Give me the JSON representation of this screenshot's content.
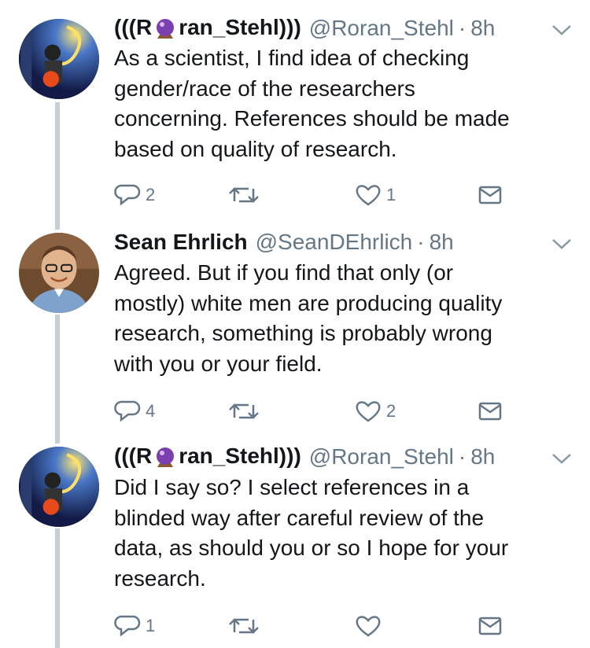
{
  "tweets": [
    {
      "name_prefix": "(((R",
      "name_suffix": "ran_Stehl)))",
      "handle": "@Roran_Stehl",
      "time": "8h",
      "lines": [
        "As a scientist, I find idea of checking",
        "gender/race of the researchers",
        "concerning. References should be made",
        "based on quality of research."
      ],
      "replies": "2",
      "retweets": "",
      "likes": "1"
    },
    {
      "name_prefix": "Sean Ehrlich",
      "name_suffix": "",
      "handle": "@SeanDEhrlich",
      "time": "8h",
      "lines": [
        "Agreed. But if you find that only (or",
        "mostly) white men are producing quality",
        "research, something is probably wrong",
        "with you or your field."
      ],
      "replies": "4",
      "retweets": "",
      "likes": "2"
    },
    {
      "name_prefix": "(((R",
      "name_suffix": "ran_Stehl)))",
      "handle": "@Roran_Stehl",
      "time": "8h",
      "lines": [
        "Did I say so? I select references in a",
        "blinded way after careful review of the",
        "data, as should you or so I hope for your",
        "research."
      ],
      "replies": "1",
      "retweets": "",
      "likes": ""
    }
  ],
  "separator": "·",
  "icons": {
    "reply": "reply-icon",
    "retweet": "retweet-icon",
    "like": "heart-icon",
    "dm": "envelope-icon",
    "menu": "chevron-down-icon",
    "name_emoji": "crystal-ball-icon"
  },
  "colors": {
    "text": "#14171a",
    "secondary": "#657786",
    "thread_line": "#c4cfd6"
  }
}
